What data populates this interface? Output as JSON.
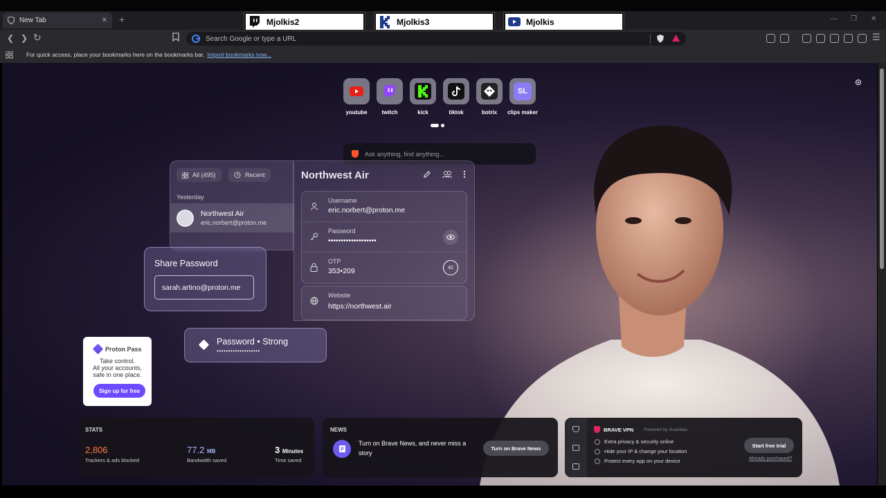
{
  "browser": {
    "tab_title": "New Tab",
    "new_tab_symbol": "+",
    "url_placeholder": "Search Google or type a URL",
    "bookmarks_message": "For quick access, place your bookmarks here on the bookmarks bar.",
    "bookmarks_link": "Import bookmarks now...",
    "window_controls": [
      "—",
      "❐",
      "✕"
    ]
  },
  "banners": [
    {
      "name": "Mjolkis2",
      "platform": "twitch"
    },
    {
      "name": "Mjolkis3",
      "platform": "kick"
    },
    {
      "name": "Mjolkis",
      "platform": "youtube"
    }
  ],
  "shortcuts": [
    {
      "label": "youtube",
      "icon": "youtube-icon",
      "color": "#e62117"
    },
    {
      "label": "twitch",
      "icon": "twitch-icon",
      "color": "#9146ff"
    },
    {
      "label": "kick",
      "icon": "kick-icon",
      "color": "#53fc18"
    },
    {
      "label": "tiktok",
      "icon": "tiktok-icon",
      "color": "#111111"
    },
    {
      "label": "botrix",
      "icon": "botrix-icon",
      "color": "#222222"
    },
    {
      "label": "clips maker",
      "icon": "sl-icon",
      "color": "#8b7cf6",
      "text": "SL"
    }
  ],
  "ask_bar": {
    "placeholder": "Ask anything, find anything..."
  },
  "password_manager": {
    "filters": {
      "all": "All (495)",
      "recent": "Recent"
    },
    "section": "Yesterday",
    "item": {
      "title": "Northwest Air",
      "subtitle": "eric.norbert@proton.me"
    },
    "detail_title": "Northwest Air",
    "fields": {
      "username_label": "Username",
      "username_value": "eric.norbert@proton.me",
      "password_label": "Password",
      "password_value": "•••••••••••••••••••",
      "otp_label": "OTP",
      "otp_value": "353•209",
      "otp_timer": "42",
      "website_label": "Website",
      "website_value": "https://northwest.air"
    },
    "share": {
      "title": "Share Password",
      "email": "sarah.artino@proton.me"
    },
    "strength": {
      "title": "Password • Strong",
      "dots": "•••••••••••••••••••"
    },
    "ad": {
      "brand": "Proton Pass",
      "text_line1": "Take control.",
      "text_line2": "All your accounts,",
      "text_line3": "safe in one place.",
      "button": "Sign up for free"
    }
  },
  "stats": {
    "header": "STATS",
    "trackers_value": "2,806",
    "trackers_label": "Trackers & ads blocked",
    "bandwidth_value": "77.2",
    "bandwidth_unit": "MB",
    "bandwidth_label": "Bandwidth saved",
    "time_value": "3",
    "time_unit": "Minutes",
    "time_label": "Time saved",
    "colors": {
      "trackers": "#ff7a45",
      "bandwidth": "#a6b4ff",
      "time": "#ffffff"
    }
  },
  "news": {
    "header": "NEWS",
    "text": "Turn on Brave News, and never miss a story",
    "button": "Turn on Brave News"
  },
  "vpn": {
    "title": "BRAVE VPN",
    "powered": "Powered by Guardian",
    "features": [
      "Extra privacy & security online",
      "Hide your IP & change your location",
      "Protect every app on your device"
    ],
    "button": "Start free trial",
    "link": "Already purchased?"
  }
}
